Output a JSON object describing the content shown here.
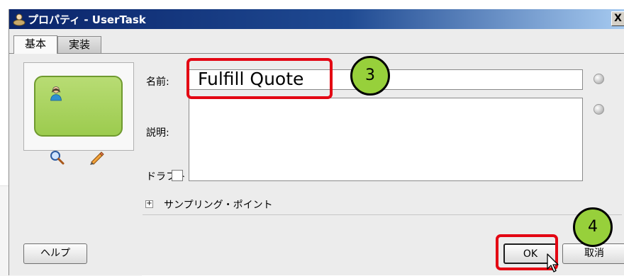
{
  "dialog": {
    "title": "プロパティ - UserTask",
    "close_label": "X"
  },
  "tabs": [
    {
      "label": "基本",
      "selected": true
    },
    {
      "label": "実装",
      "selected": false
    }
  ],
  "preview": {
    "shape_icon": "user-task-icon",
    "tools": [
      "zoom-icon",
      "edit-pencil-icon"
    ]
  },
  "form": {
    "name_label": "名前:",
    "name_value": "Fulfill Quote",
    "description_label": "説明:",
    "description_value": "",
    "draft_label": "ドラフト",
    "draft_checked": false,
    "sampling_label": "サンプリング・ポイント",
    "sampling_expander": "+"
  },
  "buttons": {
    "help": "ヘルプ",
    "ok": "OK",
    "cancel": "取消"
  },
  "annotations": {
    "step3": "3",
    "step4": "4",
    "highlight_color": "#e30613",
    "callout_color": "#97d03b"
  }
}
